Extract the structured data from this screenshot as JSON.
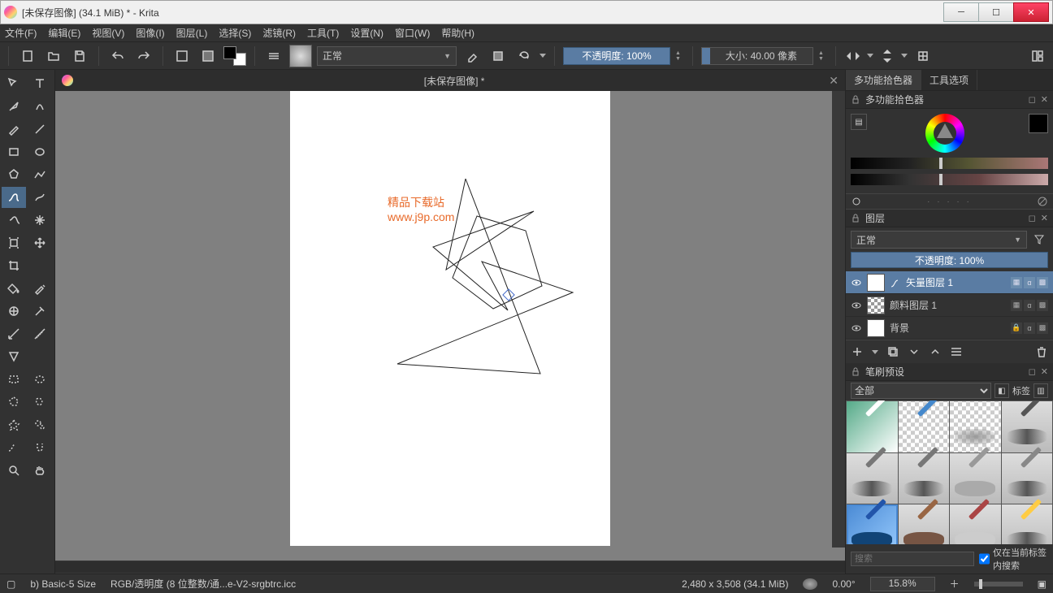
{
  "window": {
    "title": "[未保存图像] (34.1 MiB)  * - Krita"
  },
  "menu": {
    "file": "文件(F)",
    "edit": "编辑(E)",
    "view": "视图(V)",
    "image": "图像(I)",
    "layer": "图层(L)",
    "select": "选择(S)",
    "filter": "滤镜(R)",
    "tool": "工具(T)",
    "settings": "设置(N)",
    "window": "窗口(W)",
    "help": "帮助(H)"
  },
  "toolbar": {
    "blend_mode": "正常",
    "opacity_label": "不透明度: 100%",
    "size_label": "大小: 40.00 像素"
  },
  "document": {
    "tab_title": "[未保存图像]  *"
  },
  "canvas": {
    "watermark_line1": "精品下载站",
    "watermark_line2": "www.j9p.com"
  },
  "right_tabs": {
    "color_picker": "多功能拾色器",
    "tool_options": "工具选项"
  },
  "color_docker": {
    "title": "多功能拾色器"
  },
  "layers_docker": {
    "title": "图层",
    "blend_mode": "正常",
    "opacity_label": "不透明度: 100%",
    "layers": [
      {
        "name": "矢量图层 1",
        "selected": true
      },
      {
        "name": "颜料图层 1",
        "selected": false
      },
      {
        "name": "背景",
        "selected": false
      }
    ]
  },
  "brush_docker": {
    "title": "笔刷预设",
    "filter_all": "全部",
    "tag_label": "标签",
    "search_placeholder": "搜索",
    "only_current_tag": "仅在当前标签内搜索"
  },
  "status": {
    "brush_name": "b) Basic-5 Size",
    "color_profile": "RGB/透明度 (8 位整数/通...e-V2-srgbtrc.icc",
    "dimensions": "2,480 x 3,508 (34.1 MiB)",
    "rotation": "0.00°",
    "zoom": "15.8%"
  }
}
